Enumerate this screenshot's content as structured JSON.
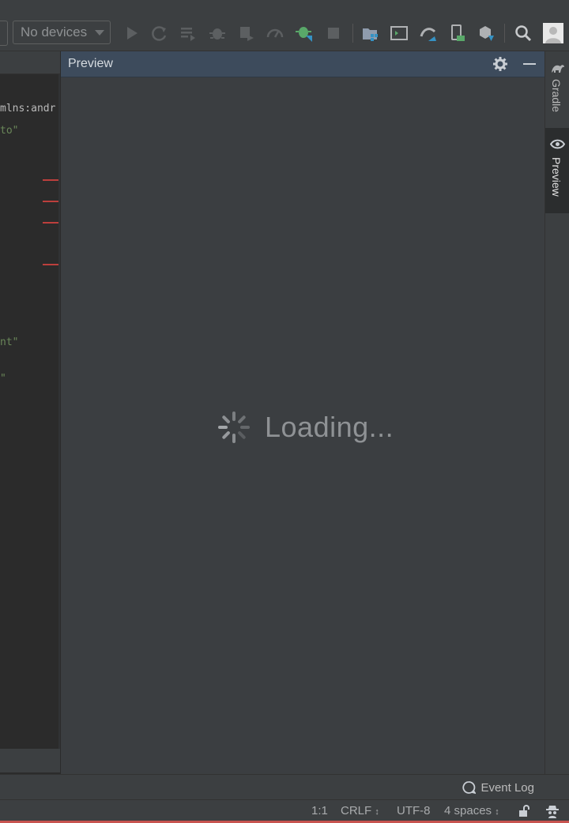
{
  "toolbar": {
    "device_selector": "No devices",
    "icons": [
      "run-icon",
      "apply-changes-icon",
      "apply-code-changes-icon",
      "debug-icon",
      "attach-debugger-icon",
      "profile-icon",
      "debug-attach-icon",
      "stop-icon",
      "project-structure-icon",
      "avd-manager-icon",
      "sync-gradle-icon",
      "device-manager-icon",
      "sdk-manager-icon",
      "search-icon",
      "account-icon"
    ]
  },
  "editor": {
    "lines": [
      "mlns:andr",
      "to\"",
      "nt\"",
      "\""
    ],
    "error_count_badge": "!"
  },
  "preview": {
    "title": "Preview",
    "loading_text": "Loading..."
  },
  "right_stripe": {
    "gradle_label": "Gradle",
    "preview_label": "Preview"
  },
  "tool_bottom": {
    "event_log_label": "Event Log"
  },
  "status_bar": {
    "position": "1:1",
    "line_separator": "CRLF",
    "encoding": "UTF-8",
    "indent": "4 spaces"
  },
  "colors": {
    "background": "#2b2b2b",
    "panel": "#3c3f41",
    "preview_header": "#3d4b5c",
    "error": "#bc3f3c",
    "run_green": "#59a869"
  }
}
